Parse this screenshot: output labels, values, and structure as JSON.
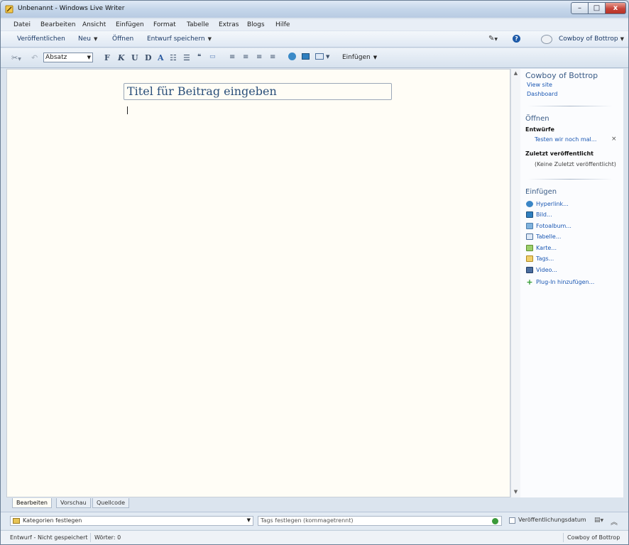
{
  "window": {
    "title": "Unbenannt - Windows Live Writer",
    "min": "–",
    "max": "□",
    "close": "x"
  },
  "menu": [
    "Datei",
    "Bearbeiten",
    "Ansicht",
    "Einfügen",
    "Format",
    "Tabelle",
    "Extras",
    "Blogs",
    "Hilfe"
  ],
  "commands": {
    "publish": "Veröffentlichen",
    "new": "Neu",
    "open": "Öffnen",
    "save_draft": "Entwurf speichern",
    "blog_name": "Cowboy of Bottrop",
    "help": "?"
  },
  "format": {
    "style_value": "Absatz",
    "bold": "F",
    "italic": "K",
    "underline": "U",
    "strike": "D",
    "font_color": "A",
    "insert_label": "Einfügen"
  },
  "editor": {
    "title_placeholder": "Titel für Beitrag eingeben"
  },
  "sidebar": {
    "blog_title": "Cowboy of Bottrop",
    "view_site": "View site",
    "dashboard": "Dashboard",
    "open_heading": "Öffnen",
    "drafts_heading": "Entwürfe",
    "draft_item": "Testen wir noch mal...",
    "recent_heading": "Zuletzt veröffentlicht",
    "recent_empty": "(Keine Zuletzt veröffentlicht)",
    "insert_heading": "Einfügen",
    "insert_items": [
      {
        "label": "Hyperlink...",
        "icon": "hyperlink-icon"
      },
      {
        "label": "Bild...",
        "icon": "image-icon"
      },
      {
        "label": "Fotoalbum...",
        "icon": "photo-album-icon"
      },
      {
        "label": "Tabelle...",
        "icon": "table-icon"
      },
      {
        "label": "Karte...",
        "icon": "map-icon"
      },
      {
        "label": "Tags...",
        "icon": "tags-icon"
      },
      {
        "label": "Video...",
        "icon": "video-icon"
      },
      {
        "label": "Plug-In hinzufügen...",
        "icon": "plugin-add-icon"
      }
    ]
  },
  "tabs": [
    "Bearbeiten",
    "Vorschau",
    "Quellcode"
  ],
  "properties": {
    "categories": "Kategorien festlegen",
    "tags_placeholder": "Tags festlegen (kommagetrennt)",
    "publish_date": "Veröffentlichungsdatum"
  },
  "status": {
    "state": "Entwurf - Nicht gespeichert",
    "words": "Wörter: 0",
    "blog": "Cowboy of Bottrop"
  }
}
